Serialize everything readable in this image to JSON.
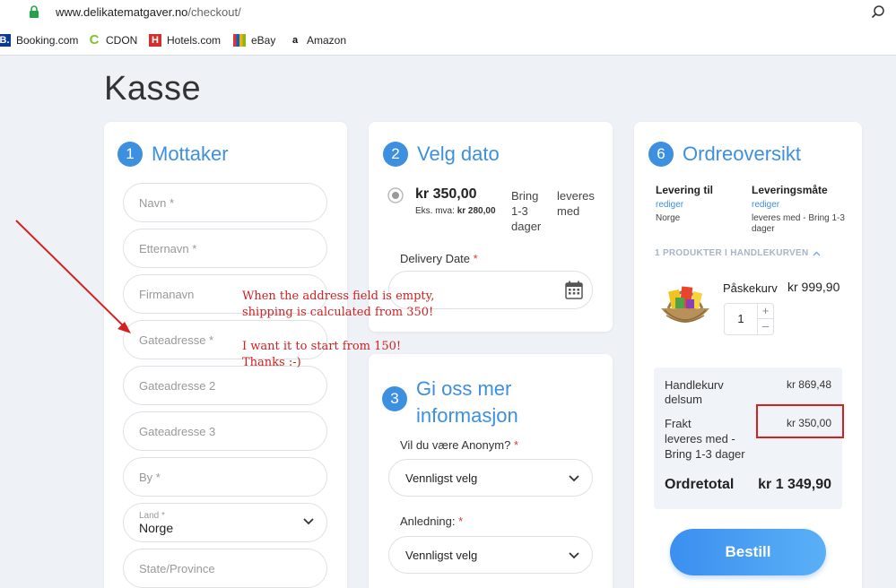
{
  "browser": {
    "url_domain": "www.delikatematgaver.no",
    "url_path": "/checkout/",
    "bookmarks": [
      {
        "label": "Booking.com",
        "icon": "booking-icon"
      },
      {
        "label": "CDON",
        "icon": "cdon-icon"
      },
      {
        "label": "Hotels.com",
        "icon": "hotels-icon"
      },
      {
        "label": "eBay",
        "icon": "ebay-icon"
      },
      {
        "label": "Amazon",
        "icon": "amazon-icon"
      }
    ]
  },
  "page": {
    "title": "Kasse"
  },
  "recipient": {
    "step": "1",
    "title": "Mottaker",
    "fields": {
      "first_name": "Navn *",
      "last_name": "Etternavn *",
      "company": "Firmanavn",
      "address1": "Gateadresse *",
      "address2": "Gateadresse 2",
      "address3": "Gateadresse 3",
      "city": "By *",
      "country_label": "Land *",
      "country_value": "Norge",
      "state": "State/Province"
    }
  },
  "date": {
    "step": "2",
    "title": "Velg dato",
    "shipping_price": "kr 350,00",
    "shipping_ex_vat_label": "Eks. mva:",
    "shipping_ex_vat": "kr 280,00",
    "shipping_method": "Bring 1-3 dager",
    "shipping_desc": "leveres med",
    "delivery_date_label": "Delivery Date",
    "required_mark": "*"
  },
  "info": {
    "step": "3",
    "title": "Gi oss mer informasjon",
    "anon_label": "Vil du være Anonym?",
    "anon_value": "Vennligst velg",
    "occasion_label": "Anledning:",
    "occasion_value": "Vennligst velg",
    "required_mark": "*"
  },
  "order": {
    "step": "6",
    "title": "Ordreoversikt",
    "delivery_to_label": "Levering til",
    "delivery_to_edit": "rediger",
    "delivery_to_value": "Norge",
    "method_label": "Leveringsmåte",
    "method_edit": "rediger",
    "method_value": "leveres med - Bring 1-3 dager",
    "cart_count_label": "1 PRODUKTER I HANDLEKURVEN",
    "product_name": "Påskekurv",
    "product_price": "kr 999,90",
    "quantity": "1",
    "subtotal_label": "Handlekurv delsum",
    "subtotal_value": "kr 869,48",
    "shipping_label": "Frakt",
    "shipping_sub": "leveres med - Bring 1-3 dager",
    "shipping_value": "kr 350,00",
    "total_label": "Ordretotal",
    "total_value": "kr 1 349,90",
    "submit_label": "Bestill"
  },
  "annotation": {
    "line1": "When the address field is empty,",
    "line2": "shipping is calculated from 350!",
    "line3": "I want it to start from 150!",
    "line4": "Thanks :-)"
  },
  "colors": {
    "accent": "#3d8fe0",
    "annotation": "#d02020"
  }
}
